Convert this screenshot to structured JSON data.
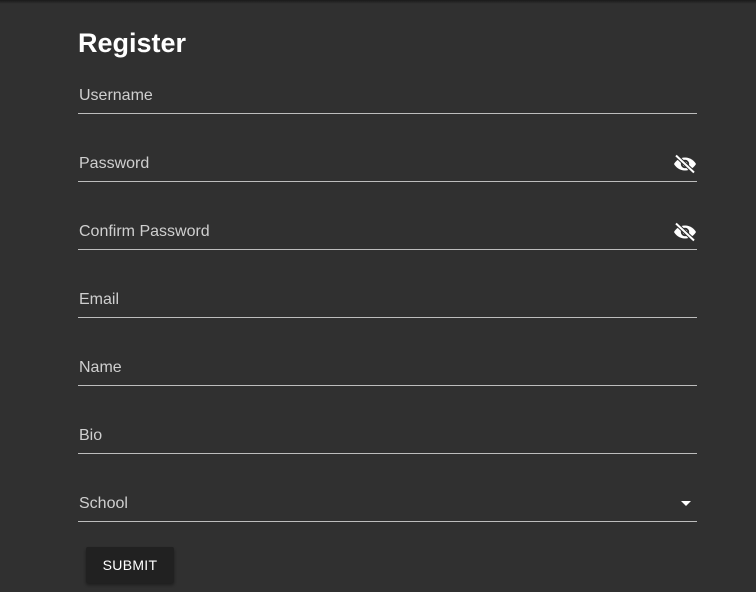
{
  "form": {
    "title": "Register",
    "fields": {
      "username": {
        "label": "Username",
        "value": ""
      },
      "password": {
        "label": "Password",
        "value": "",
        "icon": "eye-off-icon"
      },
      "confirm_password": {
        "label": "Confirm Password",
        "value": "",
        "icon": "eye-off-icon"
      },
      "email": {
        "label": "Email",
        "value": ""
      },
      "name": {
        "label": "Name",
        "value": ""
      },
      "bio": {
        "label": "Bio",
        "value": ""
      },
      "school": {
        "label": "School",
        "value": "",
        "icon": "dropdown-arrow-icon"
      }
    },
    "submit_label": "SUBMIT"
  },
  "colors": {
    "background": "#303030",
    "underline": "#bdbdbd",
    "label": "#cfcfcf",
    "button": "#212121",
    "text": "#ffffff"
  }
}
